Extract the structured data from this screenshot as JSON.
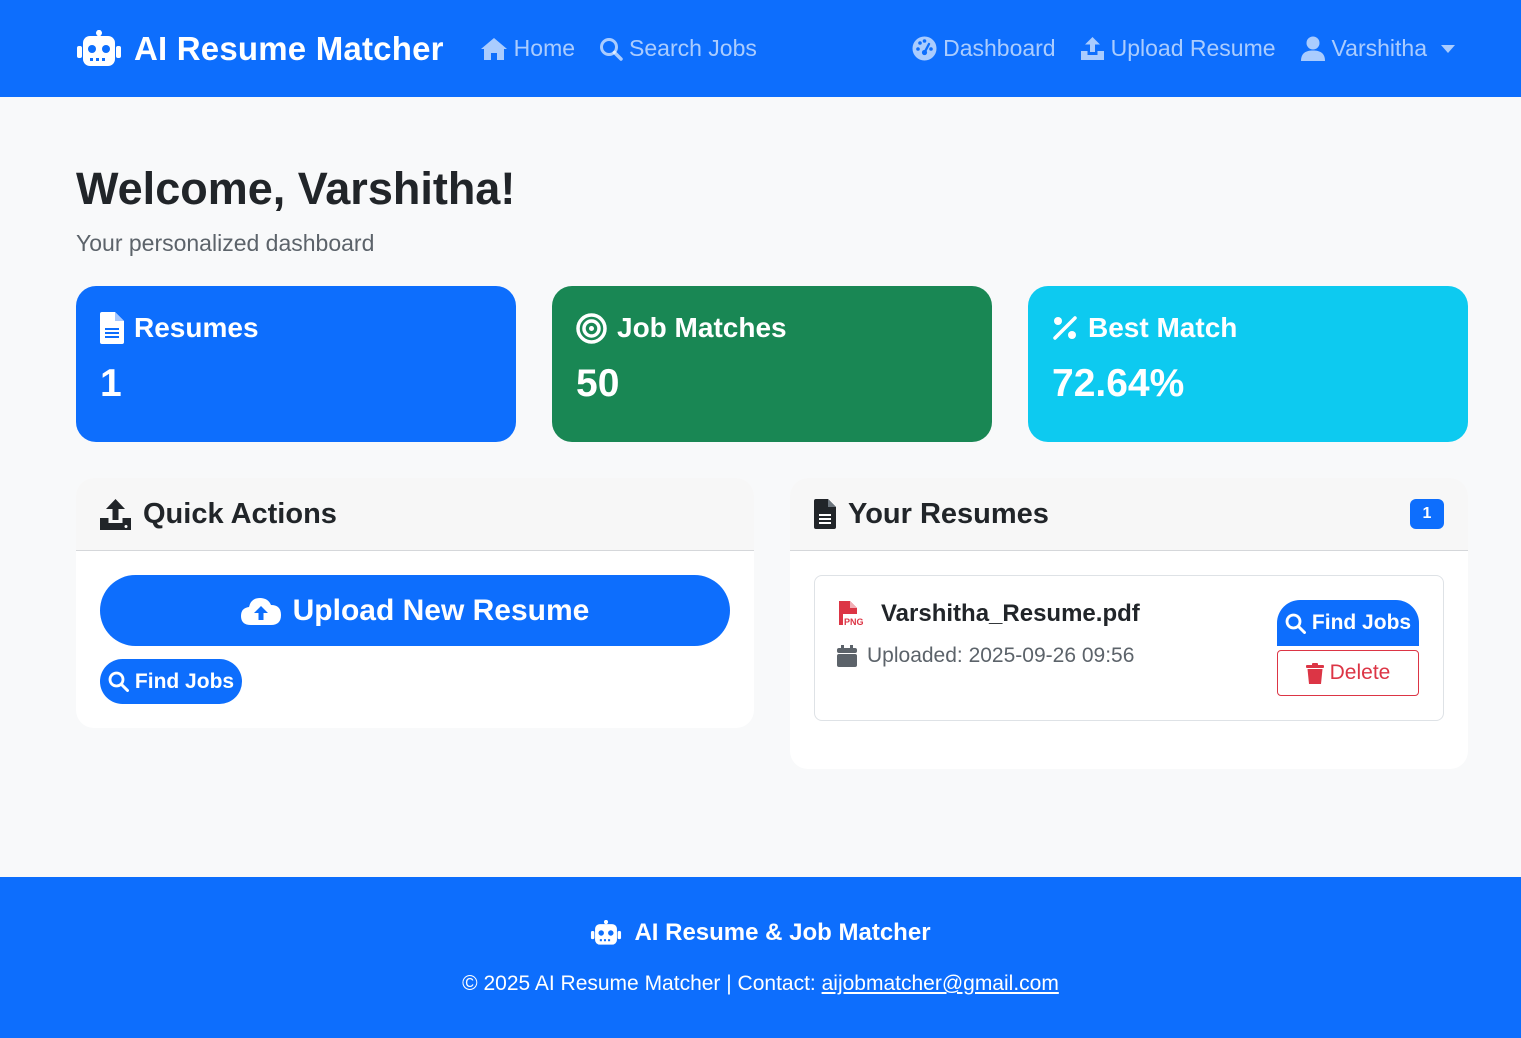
{
  "colors": {
    "primary": "#0d6efd",
    "success": "#198754",
    "info": "#0dcaf0",
    "danger": "#dc3545",
    "background": "#f8f9fa"
  },
  "navbar": {
    "brand": "AI Resume Matcher",
    "brand_icon": "robot-icon",
    "left_links": [
      {
        "label": "Home",
        "icon": "home-icon"
      },
      {
        "label": "Search Jobs",
        "icon": "search-icon"
      }
    ],
    "right_links": [
      {
        "label": "Dashboard",
        "icon": "gauge-icon"
      },
      {
        "label": "Upload Resume",
        "icon": "upload-icon"
      },
      {
        "label": "Varshitha",
        "icon": "user-icon"
      }
    ]
  },
  "header": {
    "welcome": "Welcome, Varshitha!",
    "subtitle": "Your personalized dashboard"
  },
  "stats": [
    {
      "label": "Resumes",
      "value": "1",
      "icon": "file-icon",
      "color": "#0d6efd"
    },
    {
      "label": "Job Matches",
      "value": "50",
      "icon": "target-icon",
      "color": "#198754"
    },
    {
      "label": "Best Match",
      "value": "72.64%",
      "icon": "percent-icon",
      "color": "#0dcaf0"
    }
  ],
  "quick_actions": {
    "title": "Quick Actions",
    "upload_label": "Upload New Resume",
    "find_jobs_label": "Find Jobs"
  },
  "your_resumes": {
    "title": "Your Resumes",
    "count": "1",
    "items": [
      {
        "file_name": "Varshitha_Resume.pdf",
        "uploaded": "Uploaded: 2025-09-26 09:56",
        "find_jobs_label": "Find Jobs",
        "delete_label": "Delete"
      }
    ]
  },
  "footer": {
    "title": "AI Resume & Job Matcher",
    "copyright": "© 2025 AI Resume Matcher | Contact: ",
    "email": "aijobmatcher@gmail.com"
  }
}
